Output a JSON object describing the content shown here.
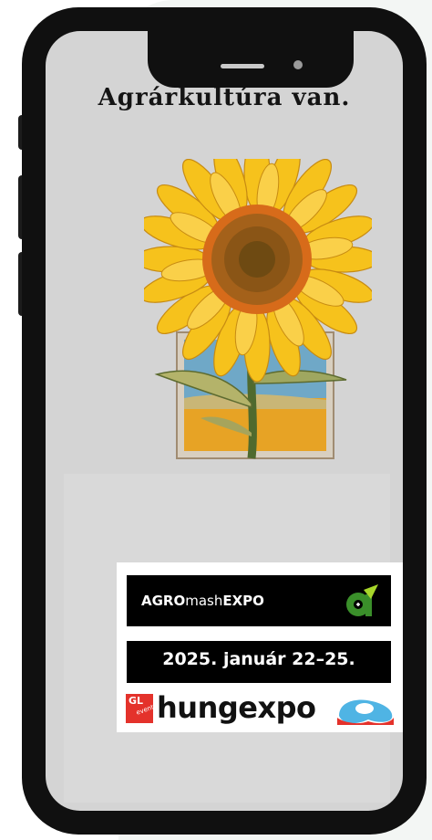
{
  "headline": "Agrárkultúra van.",
  "logos": {
    "agro_bold_1": "AGRO",
    "agro_light": "mash",
    "agro_bold_2": "EXPO",
    "date": "2025. január 22–25.",
    "gl_main": "GL",
    "gl_sub": "events",
    "hungexpo": "hungexpo"
  },
  "colors": {
    "phone_frame": "#101010",
    "screen_bg": "#d4d4d4",
    "petal": "#f6c21c",
    "sunflower_center": "#a4611a",
    "sky": "#6fa9c9",
    "field": "#e8a424",
    "logo_green": "#3a8f2a",
    "gl_red": "#e4322b",
    "hungexpo_blue": "#4fb4e4"
  },
  "icons": [
    "sunflower-illustration",
    "agromashexpo-a-icon",
    "gl-events-badge",
    "hungexpo-icon"
  ]
}
